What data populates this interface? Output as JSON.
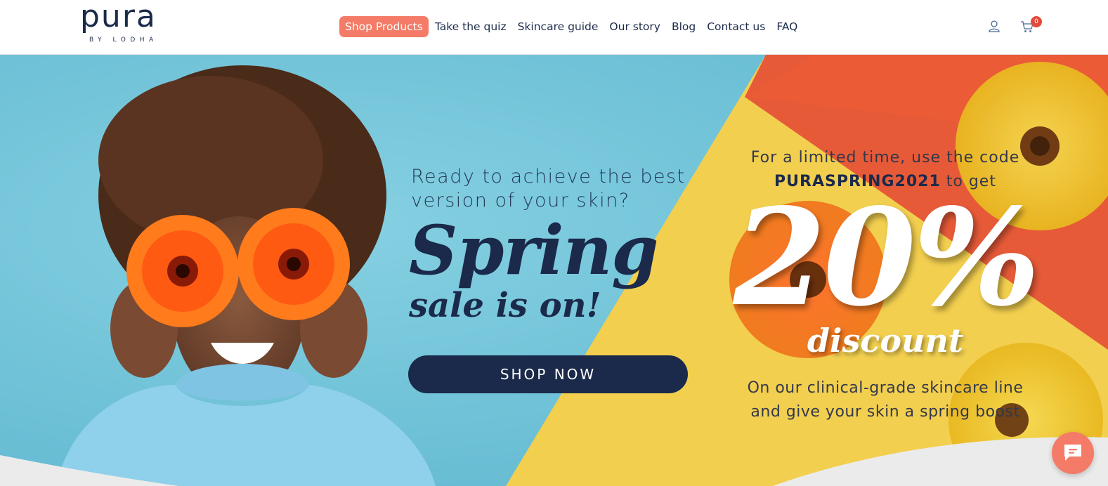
{
  "brand": {
    "name": "pura",
    "sub": "BY LODHA"
  },
  "nav": {
    "items": [
      {
        "label": "Shop Products",
        "active": true
      },
      {
        "label": "Take the quiz",
        "active": false
      },
      {
        "label": "Skincare guide",
        "active": false
      },
      {
        "label": "Our story",
        "active": false
      },
      {
        "label": "Blog",
        "active": false
      },
      {
        "label": "Contact us",
        "active": false
      },
      {
        "label": "FAQ",
        "active": false
      }
    ]
  },
  "header_icons": {
    "user": "user-icon",
    "cart": "cart-icon",
    "cart_count": "0"
  },
  "hero": {
    "headline": "Ready to achieve the best version of your skin?",
    "title": "Spring",
    "subtitle": "sale is on!",
    "cta_label": "SHOP NOW",
    "promo_line": "For a limited time, use the code",
    "promo_code": "PURASPRING2021",
    "promo_suffix": "to get",
    "discount_value": "20%",
    "discount_label": "discount",
    "footnote": "On our clinical-grade skincare line and give your skin a spring boost"
  },
  "chat": {
    "icon": "chat-icon"
  },
  "colors": {
    "navy": "#1b2a4a",
    "accent": "#f47b67",
    "sky": "#7ac8dc",
    "yellow": "#f2cf4f",
    "orange": "#e65a38",
    "badge": "#e34a3c"
  }
}
